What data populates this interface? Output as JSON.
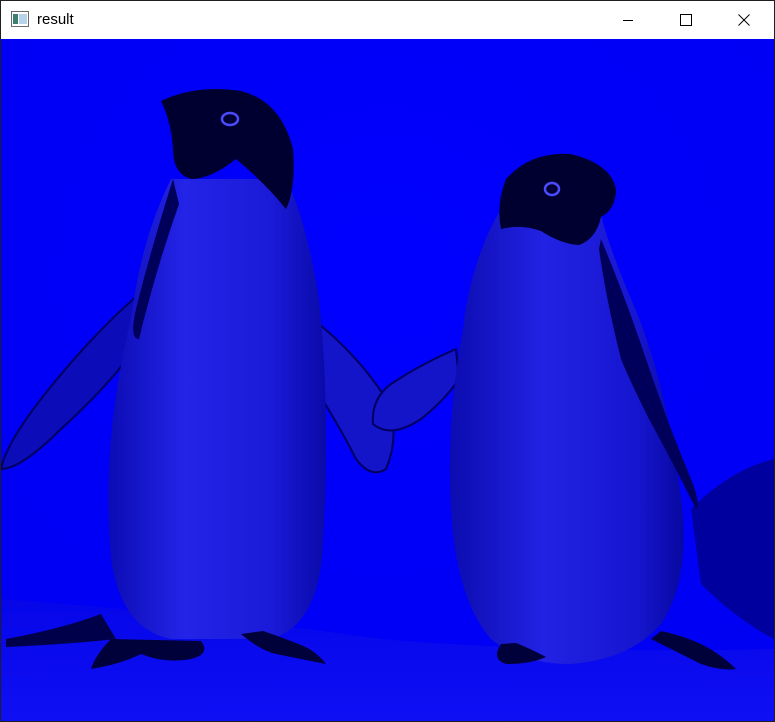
{
  "window": {
    "title": "result",
    "icon": "window-app-icon",
    "controls": {
      "minimize_icon": "minimize-icon",
      "maximize_icon": "maximize-icon",
      "close_icon": "close-icon"
    }
  },
  "image": {
    "subject": "",
    "background_color": "#0000ff",
    "shadow_color": "#00003a",
    "body_color": "#1414d6"
  }
}
